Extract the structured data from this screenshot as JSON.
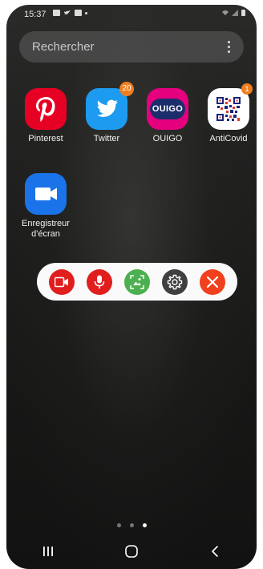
{
  "status_bar": {
    "time": "15:37"
  },
  "search": {
    "placeholder": "Rechercher"
  },
  "apps": [
    {
      "label": "Pinterest",
      "badge": ""
    },
    {
      "label": "Twitter",
      "badge": "20"
    },
    {
      "label": "OUIGO",
      "badge": ""
    },
    {
      "label": "AntiCovid",
      "badge": "1"
    },
    {
      "label": "Enregistreur d'écran",
      "badge": ""
    }
  ],
  "ouigo_logo_text": "OUIGO",
  "recorder_toolbar": {
    "buttons": [
      "record-video",
      "microphone",
      "gallery",
      "settings",
      "close"
    ]
  },
  "page_indicator": {
    "pages": 3,
    "current": 3
  },
  "colors": {
    "pinterest": "#e60023",
    "twitter": "#1d9bf0",
    "ouigo": "#e5007d",
    "recorder": "#1a73e8",
    "red_button": "#e01e1e",
    "green_button": "#4caf50",
    "gear_button": "#3f3f3f",
    "close_button": "#f0401e",
    "badge": "#f07e20"
  }
}
